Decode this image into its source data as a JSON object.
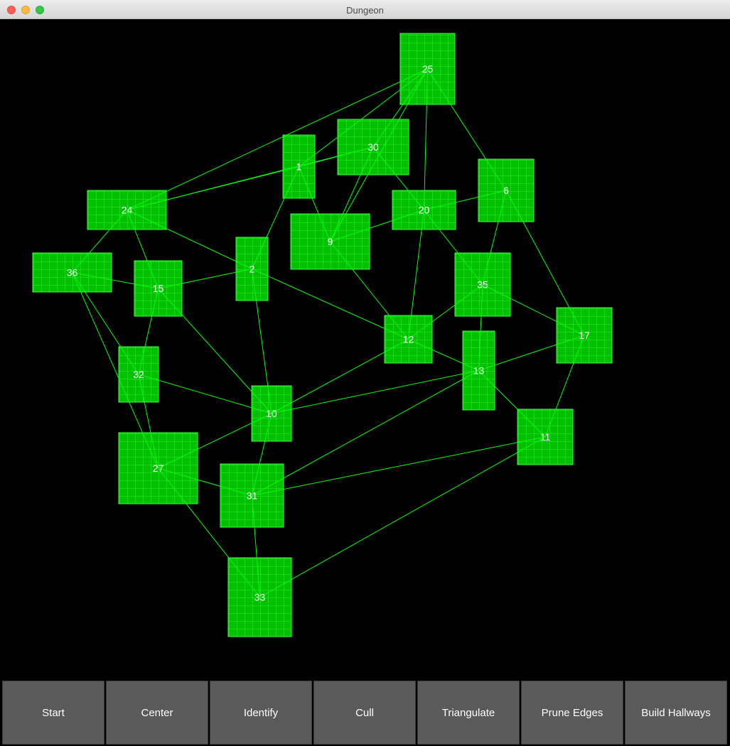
{
  "window": {
    "title": "Dungeon"
  },
  "colors": {
    "room_fill": "#00c000",
    "grid_line": "#3cff3c",
    "edge": "#00ff00",
    "background": "#000000",
    "button": "#5a5a5a"
  },
  "buttons": [
    "Start",
    "Center",
    "Identify",
    "Cull",
    "Triangulate",
    "Prune Edges",
    "Build Hallways"
  ],
  "rooms": [
    {
      "id": "25",
      "label": "25"
    },
    {
      "id": "30",
      "label": "30"
    },
    {
      "id": "1",
      "label": "1"
    },
    {
      "id": "6",
      "label": "6"
    },
    {
      "id": "24",
      "label": "24"
    },
    {
      "id": "20",
      "label": "20"
    },
    {
      "id": "9",
      "label": "9"
    },
    {
      "id": "2",
      "label": "2"
    },
    {
      "id": "36",
      "label": "36"
    },
    {
      "id": "15",
      "label": "15"
    },
    {
      "id": "35",
      "label": "35"
    },
    {
      "id": "17",
      "label": "17"
    },
    {
      "id": "12",
      "label": "12"
    },
    {
      "id": "13",
      "label": "13"
    },
    {
      "id": "32",
      "label": "32"
    },
    {
      "id": "10",
      "label": "10"
    },
    {
      "id": "11",
      "label": "11"
    },
    {
      "id": "27",
      "label": "27"
    },
    {
      "id": "31",
      "label": "31"
    },
    {
      "id": "33",
      "label": "33"
    }
  ],
  "edges": [
    [
      "25",
      "24"
    ],
    [
      "25",
      "1"
    ],
    [
      "25",
      "30"
    ],
    [
      "25",
      "20"
    ],
    [
      "25",
      "6"
    ],
    [
      "25",
      "9"
    ],
    [
      "24",
      "1"
    ],
    [
      "24",
      "30"
    ],
    [
      "24",
      "2"
    ],
    [
      "24",
      "36"
    ],
    [
      "24",
      "15"
    ],
    [
      "1",
      "30"
    ],
    [
      "1",
      "2"
    ],
    [
      "1",
      "9"
    ],
    [
      "30",
      "9"
    ],
    [
      "30",
      "20"
    ],
    [
      "9",
      "20"
    ],
    [
      "9",
      "12"
    ],
    [
      "20",
      "6"
    ],
    [
      "20",
      "12"
    ],
    [
      "20",
      "35"
    ],
    [
      "6",
      "35"
    ],
    [
      "6",
      "17"
    ],
    [
      "2",
      "15"
    ],
    [
      "2",
      "12"
    ],
    [
      "2",
      "10"
    ],
    [
      "36",
      "15"
    ],
    [
      "36",
      "32"
    ],
    [
      "36",
      "27"
    ],
    [
      "15",
      "32"
    ],
    [
      "15",
      "10"
    ],
    [
      "35",
      "12"
    ],
    [
      "35",
      "17"
    ],
    [
      "35",
      "13"
    ],
    [
      "12",
      "13"
    ],
    [
      "12",
      "10"
    ],
    [
      "17",
      "13"
    ],
    [
      "17",
      "11"
    ],
    [
      "13",
      "11"
    ],
    [
      "13",
      "10"
    ],
    [
      "13",
      "31"
    ],
    [
      "32",
      "10"
    ],
    [
      "32",
      "27"
    ],
    [
      "10",
      "27"
    ],
    [
      "10",
      "31"
    ],
    [
      "11",
      "31"
    ],
    [
      "11",
      "33"
    ],
    [
      "27",
      "31"
    ],
    [
      "27",
      "33"
    ],
    [
      "31",
      "33"
    ]
  ]
}
